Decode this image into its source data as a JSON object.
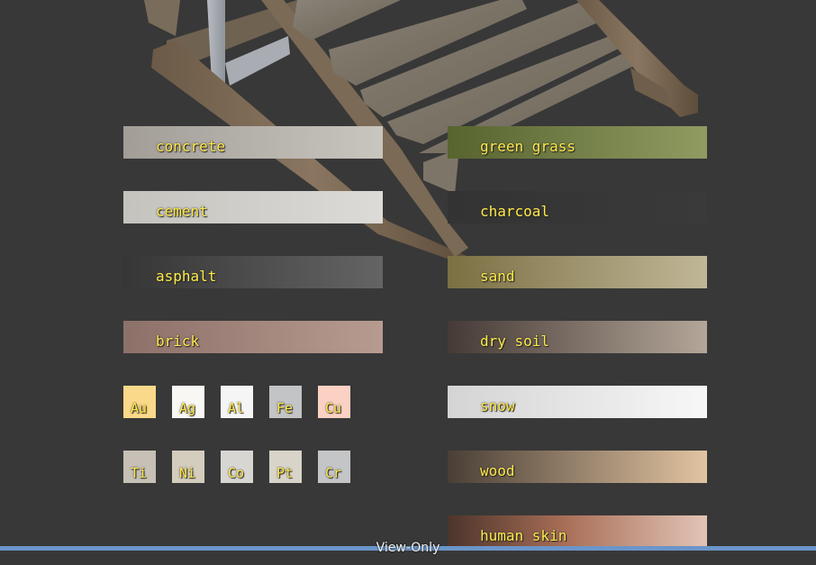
{
  "materials_left": [
    {
      "label": "concrete"
    },
    {
      "label": "cement"
    },
    {
      "label": "asphalt"
    },
    {
      "label": "brick"
    }
  ],
  "materials_right": [
    {
      "label": "green grass"
    },
    {
      "label": "charcoal"
    },
    {
      "label": "sand"
    },
    {
      "label": "dry soil"
    },
    {
      "label": "snow"
    },
    {
      "label": "wood"
    },
    {
      "label": "human skin"
    }
  ],
  "metals_row1": [
    {
      "label": "Au",
      "color": "#fbd98a"
    },
    {
      "label": "Ag",
      "color": "#f8f7f3"
    },
    {
      "label": "Al",
      "color": "#f5f5f6"
    },
    {
      "label": "Fe",
      "color": "#c3c4c5"
    },
    {
      "label": "Cu",
      "color": "#fbd1c3"
    }
  ],
  "metals_row2": [
    {
      "label": "Ti",
      "color": "#c6c0b6"
    },
    {
      "label": "Ni",
      "color": "#d4ccbc"
    },
    {
      "label": "Co",
      "color": "#d7d6d2"
    },
    {
      "label": "Pt",
      "color": "#d8d4c9"
    },
    {
      "label": "Cr",
      "color": "#c4c5c6"
    }
  ],
  "status": {
    "mode": "View-Only"
  },
  "colors": {
    "background": "#383838",
    "label": "#ffe94a",
    "statusbar": "#6b95c9"
  }
}
